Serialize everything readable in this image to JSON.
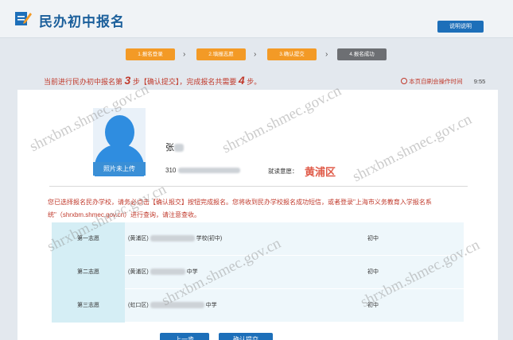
{
  "header": {
    "brand": "民办初中报名",
    "help_label": "说明说明",
    "logo_icon": "edit-pen-icon"
  },
  "steps": [
    {
      "label": "1.报名登录",
      "state": "done"
    },
    {
      "label": "2.填报志愿",
      "state": "done"
    },
    {
      "label": "3.确认提交",
      "state": "current"
    },
    {
      "label": "4.报名成功",
      "state": "pending"
    }
  ],
  "progress": {
    "prefix": "当前进行民办初中报名第",
    "current_step": "3",
    "middle": "步【确认提交】，完成报名共需要",
    "total_steps": "4",
    "suffix": "步。"
  },
  "timer": {
    "label": "本页自刷会操作时间",
    "value": "9:55"
  },
  "student": {
    "avatar_caption": "照片未上传",
    "name": "张",
    "id_prefix": "310",
    "district_label": "就读意愿：",
    "district": "黄浦区"
  },
  "notice": "您已选择报名民办学校，请务必点击【确认报交】按钮完成报名。您将收到民办学校报名成功短信，或者登录\"上海市义务教育入学报名系统\"（shrxbm.shmec.gov.cn）进行查询，请注意查收。",
  "wishes": [
    {
      "label": "第一志愿",
      "district": "(黄浦区)",
      "school_suffix": "学校(初中)",
      "type": "初中"
    },
    {
      "label": "第二志愿",
      "district": "(黄浦区)",
      "school_suffix": "中学",
      "type": "初中"
    },
    {
      "label": "第三志愿",
      "district": "(虹口区)",
      "school_suffix": "中学",
      "type": "初中"
    }
  ],
  "buttons": {
    "prev": "上一步",
    "confirm": "确认提交"
  },
  "watermark": "shrxbm.shmec.gov.cn",
  "colors": {
    "accent": "#1d6fb9",
    "step_active": "#f39a26",
    "step_pending": "#6d6f73",
    "warning": "#c0392b"
  }
}
